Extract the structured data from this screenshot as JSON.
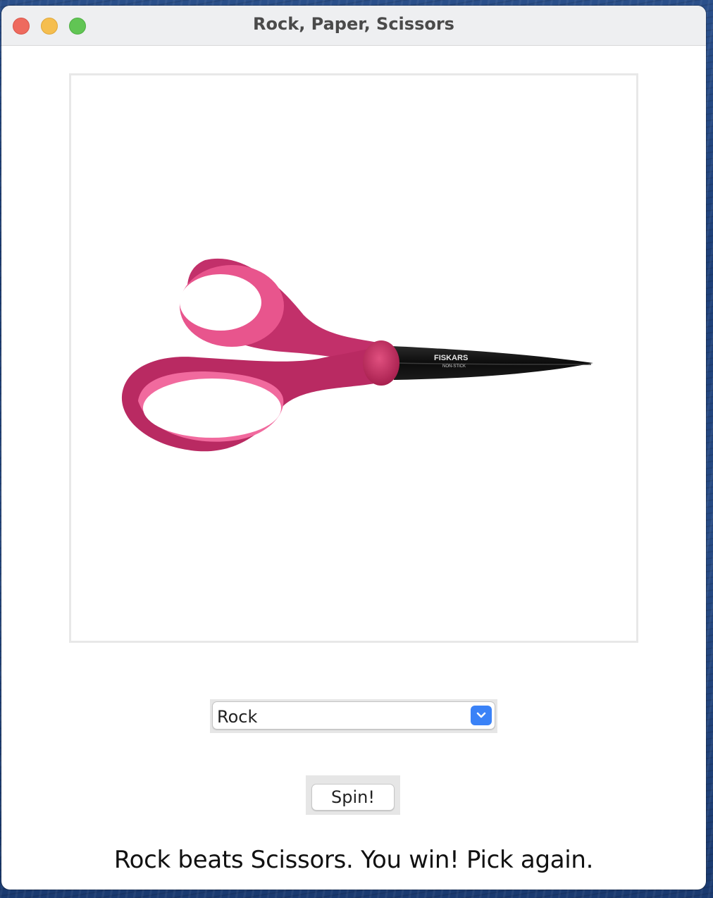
{
  "window": {
    "title": "Rock, Paper, Scissors"
  },
  "image": {
    "subject": "scissors",
    "blade_text": "FISKARS",
    "blade_subtext": "NON-STICK",
    "handle_color": "#c8326b",
    "handle_inner_color": "#f26aa0",
    "blade_color": "#111111"
  },
  "choice_select": {
    "value": "Rock"
  },
  "spin_button": {
    "label": "Spin!"
  },
  "result": {
    "message": "Rock beats Scissors. You win! Pick again."
  },
  "colors": {
    "select_accent": "#3a82f7"
  }
}
